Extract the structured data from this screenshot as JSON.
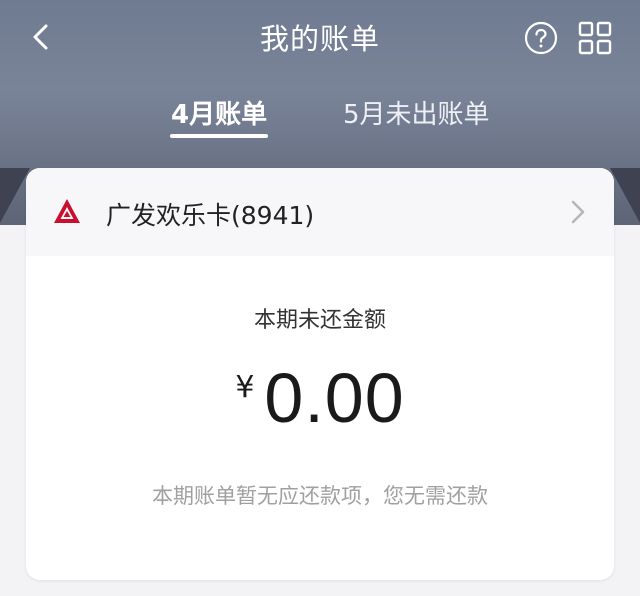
{
  "header": {
    "title": "我的账单",
    "back_icon": "chevron-left-icon",
    "help_icon": "question-circle-icon",
    "menu_icon": "grid-icon"
  },
  "tabs": [
    {
      "label": "4月账单",
      "active": true
    },
    {
      "label": "5月未出账单",
      "active": false
    }
  ],
  "card": {
    "name": "广发欢乐卡(8941)",
    "logo_icon": "bank-logo-icon",
    "logo_color": "#c8102e",
    "amount_label": "本期未还金额",
    "currency": "¥",
    "amount": "0.00",
    "note": "本期账单暂无应还款项，您无需还款"
  }
}
